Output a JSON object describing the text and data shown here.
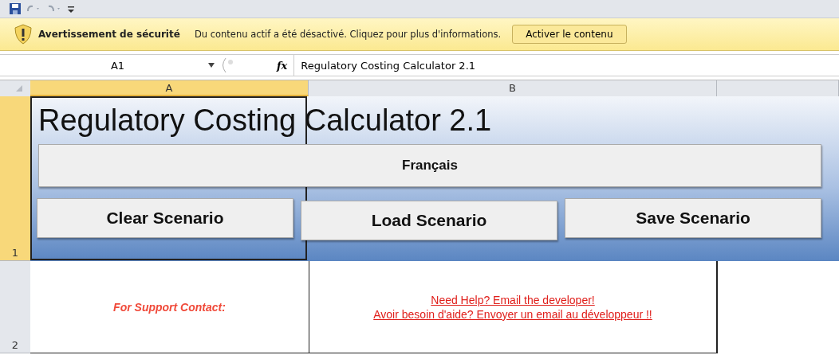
{
  "security_bar": {
    "title": "Avertissement de sécurité",
    "message": "Du contenu actif a été désactivé. Cliquez pour plus d'informations.",
    "button": "Activer le contenu"
  },
  "formula_bar": {
    "name_box": "A1",
    "fx": "fx",
    "formula": "Regulatory Costing Calculator 2.1"
  },
  "columns": [
    {
      "label": "A",
      "selected": true
    },
    {
      "label": "B",
      "selected": false
    },
    {
      "selected": false
    }
  ],
  "rows": [
    {
      "label": "1",
      "selected": true
    },
    {
      "label": "2",
      "selected": false
    }
  ],
  "sheet": {
    "title": "Regulatory Costing Calculator 2.1",
    "language_button": "Français",
    "buttons": [
      "Clear Scenario",
      "Load Scenario",
      "Save Scenario"
    ],
    "support_label": "For Support Contact:",
    "help_links": [
      "Need Help? Email the developer!",
      "Avoir besoin d'aide? Envoyer un email au développeur !!"
    ]
  }
}
